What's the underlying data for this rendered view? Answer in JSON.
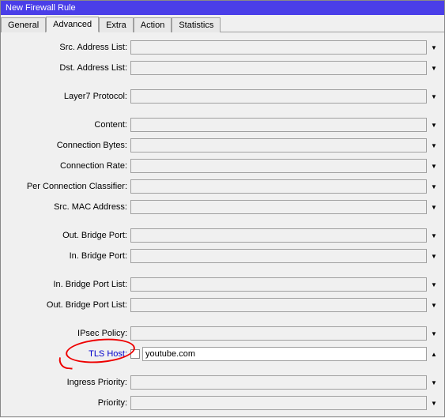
{
  "window": {
    "title": "New Firewall Rule"
  },
  "tabs": {
    "general": "General",
    "advanced": "Advanced",
    "extra": "Extra",
    "action": "Action",
    "statistics": "Statistics"
  },
  "fields": {
    "src_addr_list": {
      "label": "Src. Address List:",
      "value": ""
    },
    "dst_addr_list": {
      "label": "Dst. Address List:",
      "value": ""
    },
    "layer7": {
      "label": "Layer7 Protocol:",
      "value": ""
    },
    "content": {
      "label": "Content:",
      "value": ""
    },
    "conn_bytes": {
      "label": "Connection Bytes:",
      "value": ""
    },
    "conn_rate": {
      "label": "Connection Rate:",
      "value": ""
    },
    "pcc": {
      "label": "Per Connection Classifier:",
      "value": ""
    },
    "src_mac": {
      "label": "Src. MAC Address:",
      "value": ""
    },
    "out_bridge": {
      "label": "Out. Bridge Port:",
      "value": ""
    },
    "in_bridge": {
      "label": "In. Bridge Port:",
      "value": ""
    },
    "in_bridge_list": {
      "label": "In. Bridge Port List:",
      "value": ""
    },
    "out_bridge_list": {
      "label": "Out. Bridge Port List:",
      "value": ""
    },
    "ipsec": {
      "label": "IPsec Policy:",
      "value": ""
    },
    "tls_host": {
      "label": "TLS Host:",
      "value": "youtube.com"
    },
    "ingress_pri": {
      "label": "Ingress Priority:",
      "value": ""
    },
    "priority": {
      "label": "Priority:",
      "value": ""
    }
  }
}
